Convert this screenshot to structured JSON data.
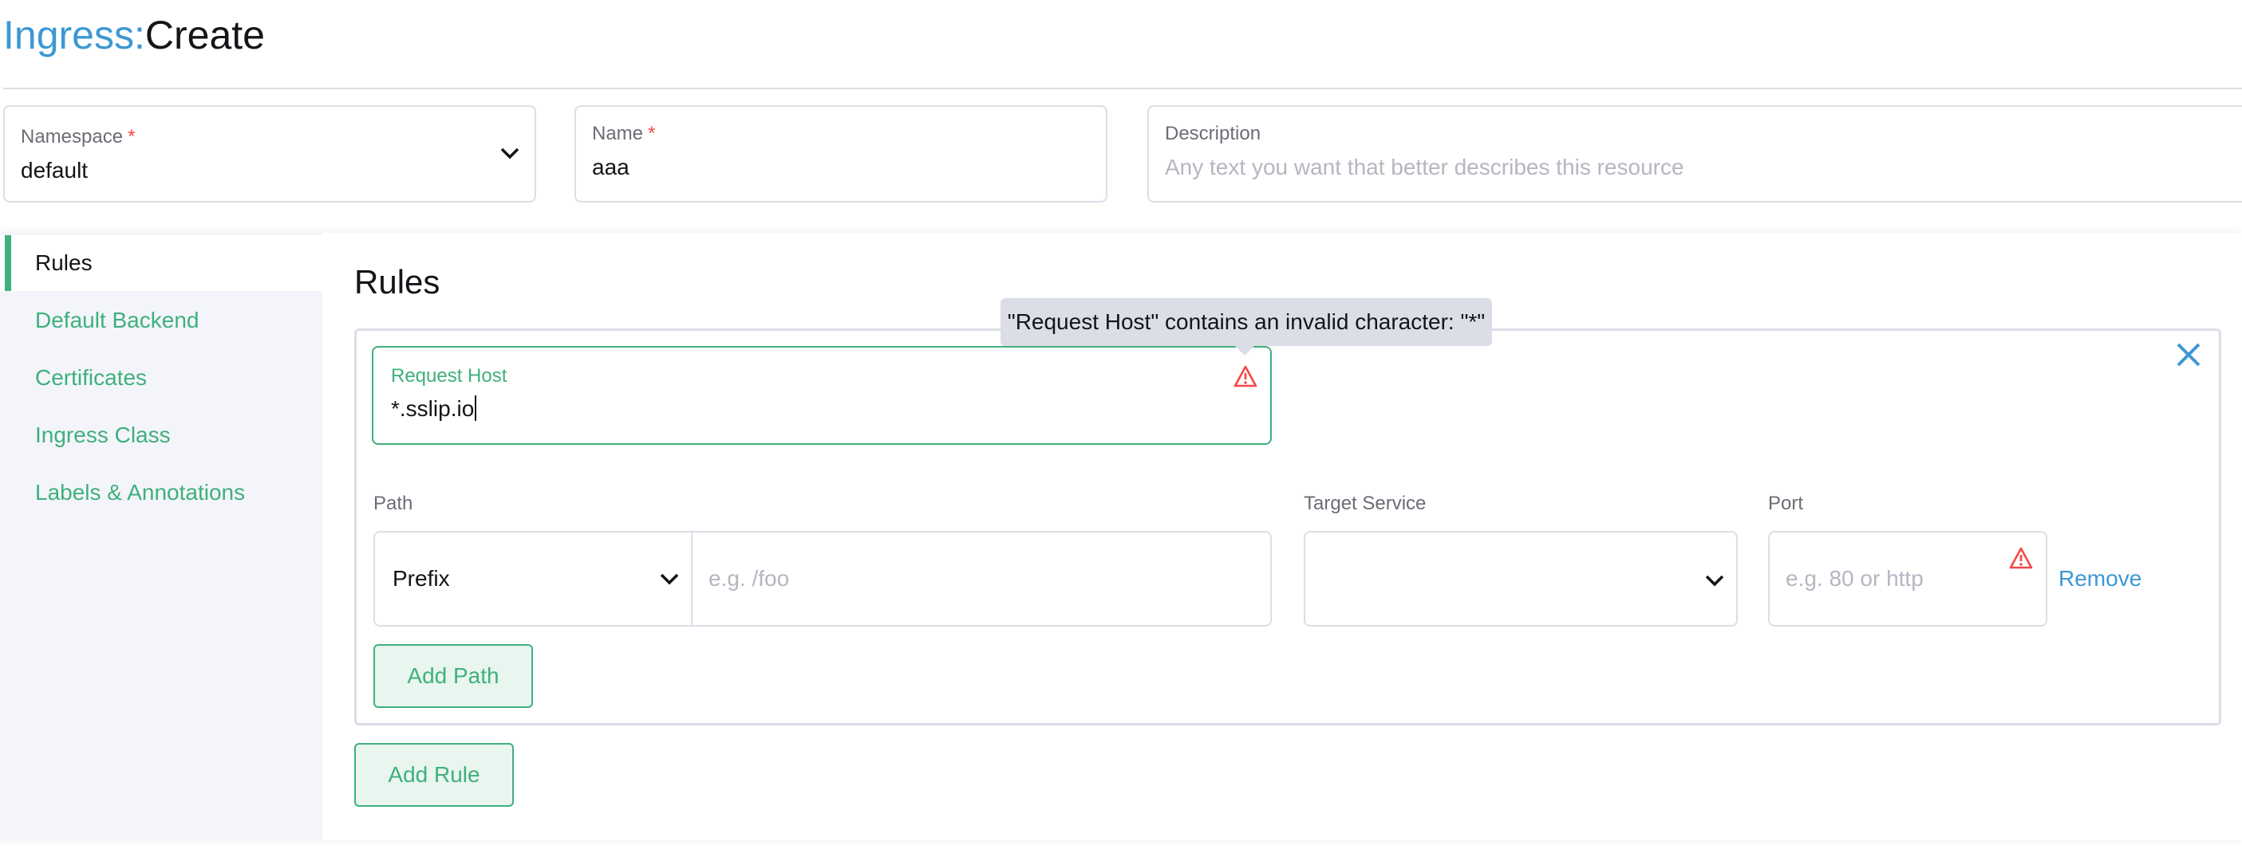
{
  "header": {
    "resource": "Ingress",
    "separator": ":",
    "action": "Create"
  },
  "form": {
    "namespace": {
      "label": "Namespace",
      "required": "*",
      "value": "default",
      "icon": "chevron-down-icon"
    },
    "name": {
      "label": "Name",
      "required": "*",
      "value": "aaa"
    },
    "description": {
      "label": "Description",
      "placeholder": "Any text you want that better describes this resource"
    }
  },
  "sidebar": {
    "items": [
      {
        "label": "Rules",
        "active": true
      },
      {
        "label": "Default Backend",
        "active": false
      },
      {
        "label": "Certificates",
        "active": false
      },
      {
        "label": "Ingress Class",
        "active": false
      },
      {
        "label": "Labels & Annotations",
        "active": false
      }
    ]
  },
  "rules": {
    "heading": "Rules",
    "request_host": {
      "label": "Request Host",
      "value": "*.sslip.io",
      "error_icon": "warning-icon",
      "tooltip": "\"Request Host\" contains an invalid character: \"*\""
    },
    "path": {
      "label": "Path",
      "type_value": "Prefix",
      "placeholder": "e.g. /foo"
    },
    "target_service": {
      "label": "Target Service",
      "value": ""
    },
    "port": {
      "label": "Port",
      "placeholder": "e.g. 80 or http",
      "error_icon": "warning-icon"
    },
    "remove_label": "Remove",
    "add_path_label": "Add Path",
    "add_rule_label": "Add Rule",
    "close_icon": "close-icon"
  },
  "colors": {
    "accent_green": "#3fb07c",
    "link_blue": "#3d98d3",
    "error_red": "#f64747",
    "border": "#dcdee7"
  }
}
